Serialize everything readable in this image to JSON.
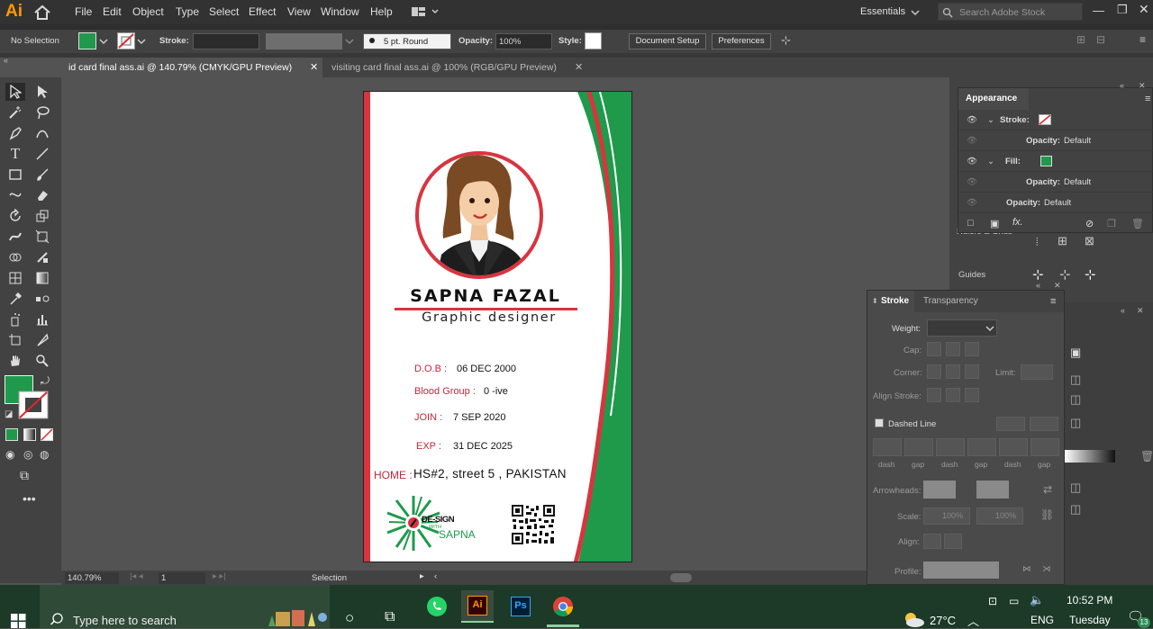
{
  "app": {
    "logo": "Ai",
    "title": "Adobe Illustrator"
  },
  "menu": [
    "File",
    "Edit",
    "Object",
    "Type",
    "Select",
    "Effect",
    "View",
    "Window",
    "Help"
  ],
  "workspace": "Essentials",
  "search_stock": {
    "placeholder": "Search Adobe Stock"
  },
  "control": {
    "selection": "No Selection",
    "stroke_label": "Stroke:",
    "brush": "5 pt. Round",
    "opacity_label": "Opacity:",
    "opacity_value": "100%",
    "style_label": "Style:",
    "document_setup": "Document Setup",
    "preferences": "Preferences"
  },
  "tabs": [
    {
      "label": "id card final ass.ai @ 140.79% (CMYK/GPU Preview)",
      "active": true
    },
    {
      "label": "visiting card final ass.ai @ 100% (RGB/GPU Preview)",
      "active": false
    }
  ],
  "status": {
    "zoom": "140.79%",
    "page": "1",
    "tool": "Selection"
  },
  "card": {
    "name": "SAPNA FAZAL",
    "title": "Graphic designer",
    "fields": [
      {
        "label": "D.O.B :",
        "value": "06 DEC 2000"
      },
      {
        "label": "Blood Group :",
        "value": "0 -ive"
      },
      {
        "label": "JOIN :",
        "value": "7 SEP 2020"
      },
      {
        "label": "EXP :",
        "value": "31 DEC 2025"
      }
    ],
    "home_label": "HOME :",
    "home_value": "HS#2, street 5 , PAKISTAN",
    "logo_line1": "DE-SIGN",
    "logo_line2": "WITH",
    "logo_line3": "SAPNA",
    "colors": {
      "red": "#d9343f",
      "green": "#1e9a4a"
    }
  },
  "appearance": {
    "tab": "Appearance",
    "rows": [
      {
        "label": "Stroke:",
        "value": ""
      },
      {
        "label": "Opacity:",
        "value": "Default"
      },
      {
        "label": "Fill:",
        "value": ""
      },
      {
        "label": "Opacity:",
        "value": "Default"
      },
      {
        "label": "Opacity:",
        "value": "Default"
      }
    ],
    "behind": [
      "Rulers & Grids",
      "Guides"
    ]
  },
  "stroke_panel": {
    "tab1": "Stroke",
    "tab2": "Transparency",
    "weight": "Weight:",
    "cap": "Cap:",
    "corner": "Corner:",
    "limit": "Limit:",
    "align": "Align Stroke:",
    "dashed": "Dashed Line",
    "dash_labels": [
      "dash",
      "gap",
      "dash",
      "gap",
      "dash",
      "gap"
    ],
    "arrowheads": "Arrowheads:",
    "scale": "Scale:",
    "scale1": "100%",
    "scale2": "100%",
    "align2": "Align:",
    "profile": "Profile:"
  },
  "taskbar": {
    "search_placeholder": "Type here to search",
    "temp": "27°C",
    "lang": "ENG",
    "time": "10:52 PM",
    "day": "Tuesday",
    "badge": "13"
  }
}
